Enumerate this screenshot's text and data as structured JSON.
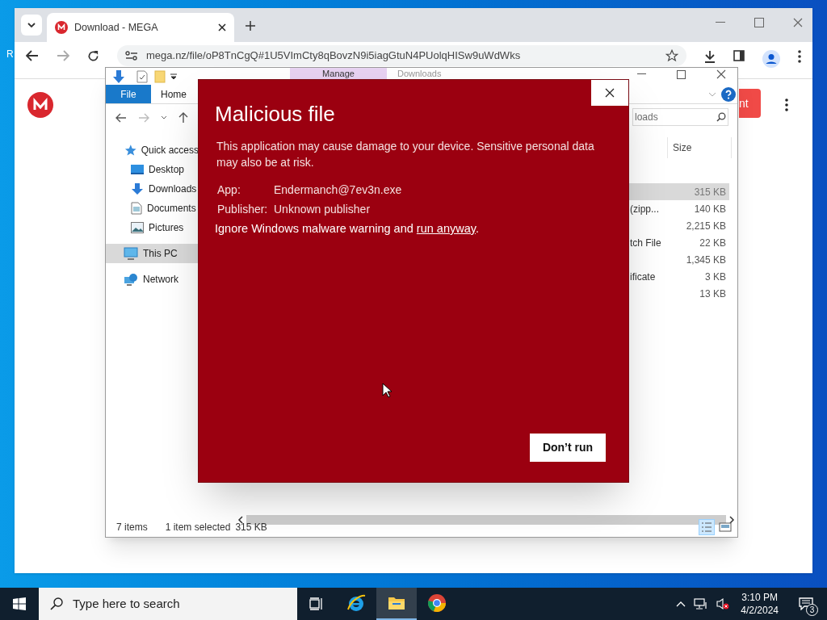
{
  "desktop": {
    "icon_label": "R"
  },
  "browser": {
    "tab": {
      "title": "Download - MEGA",
      "selected": true
    },
    "address": {
      "url": "mega.nz/file/oP8TnCgQ#1U5VImCty8qBovzN9i5iagGtuN4PUolqHISw9uWdWks"
    },
    "page": {
      "button_fragment": "nt"
    }
  },
  "explorer": {
    "contextual_tab": "Manage",
    "title": "Downloads",
    "ribbon_tabs": [
      {
        "label": "File",
        "kind": "file"
      },
      {
        "label": "Home",
        "kind": "tab"
      }
    ],
    "search": {
      "placeholder": "loads"
    },
    "nav": [
      {
        "label": "Quick access",
        "kind": "star",
        "selected": false,
        "children": [
          {
            "label": "Desktop",
            "kind": "desktop",
            "selected": false
          },
          {
            "label": "Downloads",
            "kind": "download",
            "selected": false
          },
          {
            "label": "Documents",
            "kind": "document",
            "selected": false
          },
          {
            "label": "Pictures",
            "kind": "pictures",
            "selected": false
          }
        ]
      },
      {
        "label": "This PC",
        "kind": "pc",
        "selected": true
      },
      {
        "label": "Network",
        "kind": "network",
        "selected": false
      }
    ],
    "columns": [
      "Size"
    ],
    "rows": [
      {
        "type": "",
        "size": "315 KB",
        "selected": true
      },
      {
        "type": "(zipp...",
        "size": "140 KB",
        "selected": false
      },
      {
        "type": "",
        "size": "2,215 KB",
        "selected": false
      },
      {
        "type": "tch File",
        "size": "22 KB",
        "selected": false
      },
      {
        "type": "",
        "size": "1,345 KB",
        "selected": false
      },
      {
        "type": "ificate",
        "size": "3 KB",
        "selected": false
      },
      {
        "type": "",
        "size": "13 KB",
        "selected": false
      }
    ],
    "status": {
      "count": "7 items",
      "selection": "1 item selected",
      "selection_size": "315 KB"
    }
  },
  "dialog": {
    "title": "Malicious file",
    "message": "This application may cause damage to your device. Sensitive personal data may also be at risk.",
    "details": [
      {
        "label": "App:",
        "value": "Endermanch@7ev3n.exe"
      },
      {
        "label": "Publisher:",
        "value": "Unknown publisher"
      }
    ],
    "warning_before": "Ignore Windows malware warning and",
    "warning_link": "run anyway",
    "warning_after": ".",
    "button": "Don’t run"
  },
  "taskbar": {
    "search": {
      "placeholder": "Type here to search"
    },
    "apps": [
      {
        "kind": "ie",
        "selected": false
      },
      {
        "kind": "explorer",
        "selected": true
      },
      {
        "kind": "chrome",
        "selected": false
      }
    ],
    "time": "3:10 PM",
    "date": "4/2/2024",
    "notifications": "3"
  }
}
